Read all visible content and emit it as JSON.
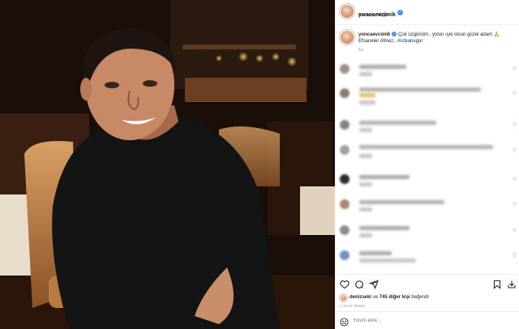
{
  "post": {
    "username": "yoncaevcimik",
    "location": "Bodrum, Muğla",
    "caption_text": "Çok üzgünüm.. yolun ışık olsun güzel adam 🙏 Efsaneler ölmez.. ",
    "caption_hashtag": "#ozkanugur",
    "caption_age": "1s",
    "liked_by_user": "denizseki",
    "likes_prefix": "ve",
    "likes_count": "745 diğer kişi",
    "likes_suffix": "beğendi",
    "post_age": "1 SAAT ÖNCE",
    "comment_placeholder": "Yorum ekle..."
  },
  "colors": {
    "verified": "#3897f0",
    "hashtag": "#00376b",
    "muted": "#8e8e8e"
  },
  "icons": [
    "verified-badge-icon",
    "more-icon",
    "heart-icon",
    "comment-icon",
    "share-icon",
    "bookmark-icon",
    "download-icon",
    "emoji-icon"
  ]
}
